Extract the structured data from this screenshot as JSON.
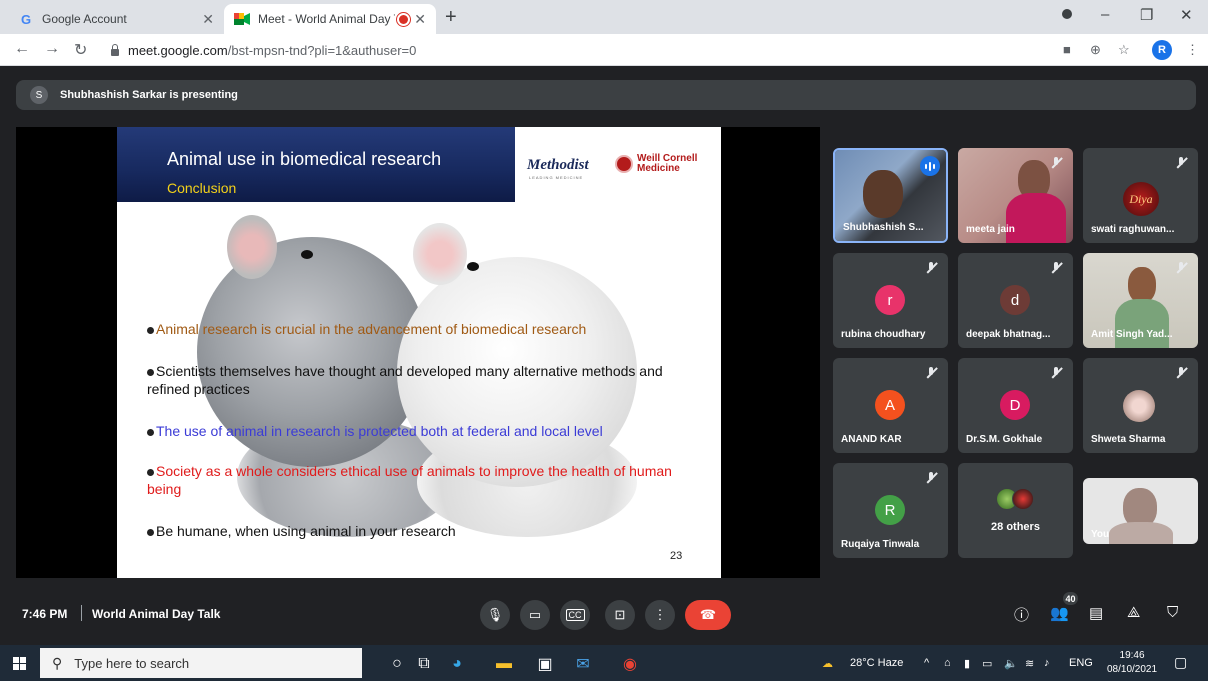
{
  "browser": {
    "tabs": [
      {
        "label": "Google Account",
        "favicon": "G",
        "active": false
      },
      {
        "label": "Meet - World Animal Day Ta",
        "favicon": "meet-icon",
        "active": true,
        "recording": true
      }
    ],
    "url_host": "meet.google.com",
    "url_path": "/bst-mpsn-tnd?pli=1&authuser=0",
    "profile_initial": "R"
  },
  "meet": {
    "presenter_initial": "S",
    "presenter_text": "Shubhashish Sarkar is presenting",
    "time": "7:46 PM",
    "meeting_name": "World Animal Day Talk",
    "people_count": "40"
  },
  "slide": {
    "title": "Animal use in biomedical research",
    "subtitle": "Conclusion",
    "logo_left": "Methodist",
    "logo_left_sub": "LEADING MEDICINE",
    "logo_right_line1": "Weill Cornell",
    "logo_right_line2": "Medicine",
    "bullets": [
      {
        "text": "Animal research is crucial in the advancement of biomedical research",
        "color": "#a05a14"
      },
      {
        "text": "Scientists themselves have thought and developed many alternative methods and refined practices",
        "color": "#111111"
      },
      {
        "text": "The use of animal in research is protected both at federal and local level",
        "color": "#3b3bd6"
      },
      {
        "text": "Society as a whole considers ethical use of animals to improve the health of human being",
        "color": "#e01b1b"
      },
      {
        "text": "Be humane, when using animal in your research",
        "color": "#111111"
      }
    ],
    "page_number": "23"
  },
  "participants": [
    {
      "name": "Shubhashish S...",
      "type": "video",
      "speaking": true
    },
    {
      "name": "meeta jain",
      "type": "video",
      "muted": true
    },
    {
      "name": "swati raghuwan...",
      "type": "image",
      "muted": true,
      "image_text": "Diya"
    },
    {
      "name": "rubina choudhary",
      "type": "avatar",
      "initial": "r",
      "color": "#e8336a",
      "muted": true
    },
    {
      "name": "deepak bhatnag...",
      "type": "avatar",
      "initial": "d",
      "color": "#6d3b36",
      "muted": true
    },
    {
      "name": "Amit Singh Yad...",
      "type": "video",
      "muted": true
    },
    {
      "name": "ANAND KAR",
      "type": "avatar",
      "initial": "A",
      "color": "#f4511e",
      "muted": true
    },
    {
      "name": "Dr.S.M. Gokhale",
      "type": "avatar",
      "initial": "D",
      "color": "#d81b60",
      "muted": true
    },
    {
      "name": "Shweta Sharma",
      "type": "image",
      "muted": true
    },
    {
      "name": "Ruqaiya Tinwala",
      "type": "avatar",
      "initial": "R",
      "color": "#43a047",
      "muted": true
    },
    {
      "name": "28 others",
      "type": "others"
    },
    {
      "name": "You",
      "type": "video"
    }
  ],
  "taskbar": {
    "search_placeholder": "Type here to search",
    "weather": "28°C  Haze",
    "language": "ENG",
    "clock_time": "19:46",
    "clock_date": "08/10/2021"
  }
}
